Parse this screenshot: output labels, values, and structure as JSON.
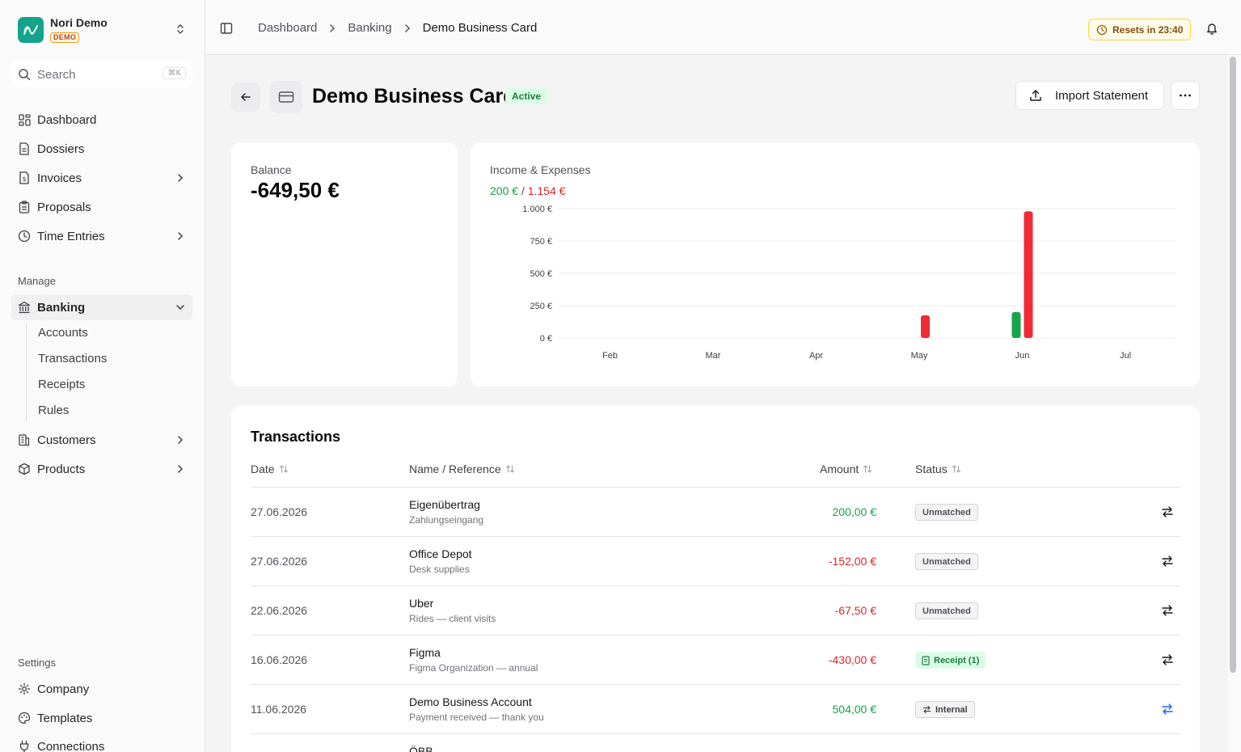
{
  "brand": {
    "name": "Nori Demo",
    "badge": "DEMO"
  },
  "search": {
    "placeholder": "Search",
    "shortcut": "⌘K"
  },
  "nav": {
    "main": [
      {
        "label": "Dashboard",
        "icon": "grid-icon"
      },
      {
        "label": "Dossiers",
        "icon": "file-icon"
      },
      {
        "label": "Invoices",
        "icon": "invoice-icon"
      },
      {
        "label": "Proposals",
        "icon": "clipboard-icon"
      },
      {
        "label": "Time Entries",
        "icon": "clock-icon"
      }
    ],
    "manage_label": "Manage",
    "banking": {
      "label": "Banking",
      "sub": [
        "Accounts",
        "Transactions",
        "Receipts",
        "Rules"
      ]
    },
    "manage": [
      {
        "label": "Customers",
        "icon": "building-icon"
      },
      {
        "label": "Products",
        "icon": "package-icon"
      }
    ],
    "settings_label": "Settings",
    "settings": [
      {
        "label": "Company",
        "icon": "gear-icon"
      },
      {
        "label": "Templates",
        "icon": "palette-icon"
      },
      {
        "label": "Connections",
        "icon": "plug-icon"
      }
    ]
  },
  "breadcrumb": [
    "Dashboard",
    "Banking",
    "Demo Business Card"
  ],
  "resets": "Resets in 23:40",
  "page": {
    "title": "Demo Business Card",
    "status": "Active",
    "import_label": "Import Statement"
  },
  "balance": {
    "label": "Balance",
    "value": "-649,50 €"
  },
  "chart": {
    "label": "Income & Expenses",
    "income": "200 €",
    "separator": "/",
    "expenses": "1.154 €"
  },
  "chart_data": {
    "type": "bar",
    "categories": [
      "Feb",
      "Mar",
      "Apr",
      "May",
      "Jun",
      "Jul"
    ],
    "series": [
      {
        "values": [
          0,
          0,
          0,
          0,
          200,
          0
        ],
        "color": "#16a34a"
      },
      {
        "values": [
          0,
          0,
          0,
          175,
          979,
          0
        ],
        "color": "#ef2b36"
      }
    ],
    "yticks": [
      "0 €",
      "250 €",
      "500 €",
      "750 €",
      "1.000 €"
    ],
    "ylim": [
      0,
      1000
    ],
    "grid": true
  },
  "transactions": {
    "title": "Transactions",
    "columns": {
      "date": "Date",
      "name": "Name / Reference",
      "amount": "Amount",
      "status": "Status"
    },
    "rows": [
      {
        "date": "27.06.2026",
        "name": "Eigenübertrag",
        "ref": "Zahlungseingang",
        "amount": "200,00 €",
        "status": "Unmatched"
      },
      {
        "date": "27.06.2026",
        "name": "Office Depot",
        "ref": "Desk supplies",
        "amount": "-152,00 €",
        "status": "Unmatched"
      },
      {
        "date": "22.06.2026",
        "name": "Uber",
        "ref": "Rides — client visits",
        "amount": "-67,50 €",
        "status": "Unmatched"
      },
      {
        "date": "16.06.2026",
        "name": "Figma",
        "ref": "Figma Organization — annual",
        "amount": "-430,00 €",
        "status": "Receipt (1)"
      },
      {
        "date": "11.06.2026",
        "name": "Demo Business Account",
        "ref": "Payment received — thank you",
        "amount": "504,00 €",
        "status": "Internal"
      },
      {
        "date": "",
        "name": "ÖBB",
        "ref": "",
        "amount": "",
        "status": ""
      }
    ]
  },
  "colors": {
    "accent": "#14a38b",
    "income": "#16a34a",
    "expense": "#ef2b36",
    "link": "#2563eb"
  }
}
